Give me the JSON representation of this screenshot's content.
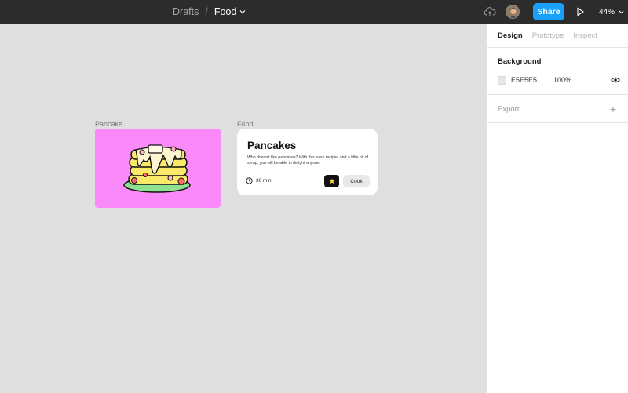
{
  "topbar": {
    "breadcrumb_parent": "Drafts",
    "separator": "/",
    "file_name": "Food",
    "share_label": "Share",
    "zoom_level": "44%"
  },
  "canvas": {
    "frames": [
      {
        "label": "Pancake"
      },
      {
        "label": "Food"
      }
    ],
    "card": {
      "title": "Pancakes",
      "description": "Who doesn't like pancakes? With this easy recipie, and a little bit of syrup, you will be able to delight anyone.",
      "time": "30 min.",
      "cook_label": "Cook"
    },
    "colors": {
      "background": "#e0dfe0",
      "pancake_frame": "#fa8afa",
      "card": "#ffffff"
    }
  },
  "panel": {
    "tabs": [
      {
        "label": "Design",
        "active": true
      },
      {
        "label": "Prototype",
        "active": false
      },
      {
        "label": "Inspect",
        "active": false
      }
    ],
    "background_title": "Background",
    "background_hex": "E5E5E5",
    "background_opacity": "100%",
    "export_title": "Export"
  },
  "icons": [
    "chevron-down-icon",
    "cloud-upload-icon",
    "avatar",
    "play-icon",
    "clock-icon",
    "star-icon",
    "eye-icon",
    "plus-icon"
  ],
  "accent_color": "#18a0fb"
}
